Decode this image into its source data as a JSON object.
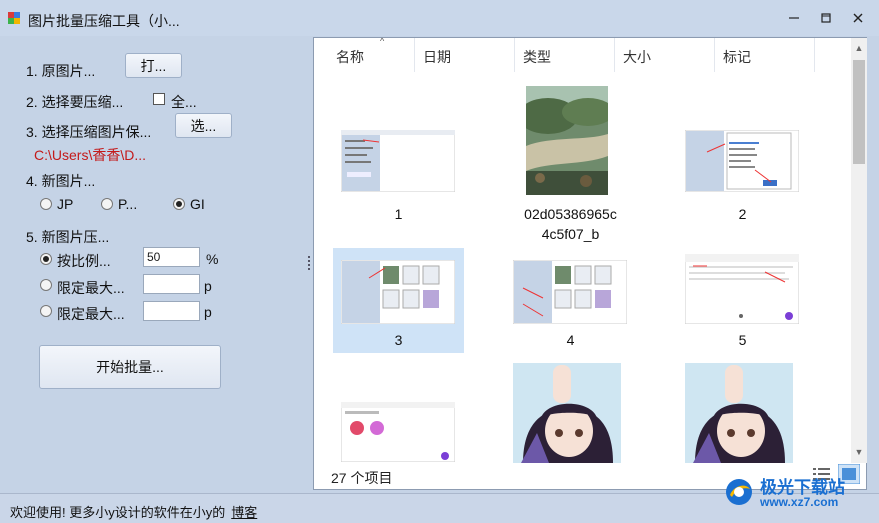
{
  "window": {
    "title": "图片批量压缩工具（小...",
    "minimize_icon": "minimize-icon",
    "maximize_icon": "maximize-icon",
    "close_icon": "close-icon"
  },
  "left": {
    "step1_label": "1. 原图片...",
    "open_button": "打...",
    "step2_label": "2. 选择要压缩...",
    "select_all_label": "全...",
    "step3_label": "3. 选择压缩图片保...",
    "choose_button": "选...",
    "save_path": "C:\\Users\\香香\\D...",
    "step4_label": "4. 新图片...",
    "format_options": [
      "JP",
      "P...",
      "GI"
    ],
    "format_selected": "GI",
    "step5_label": "5. 新图片压...",
    "ratio_label": "按比例...",
    "ratio_value": "50",
    "ratio_unit": "%",
    "max_width_label": "限定最大...",
    "max_width_unit": "p",
    "max_height_label": "限定最大...",
    "max_height_unit": "p",
    "size_mode_selected": "按比例...",
    "start_button": "开始批量..."
  },
  "explorer": {
    "columns": [
      "名称",
      "日期",
      "类型",
      "大小",
      "标记"
    ],
    "sort_column": "名称",
    "items": [
      {
        "label": "1",
        "kind": "screenshot"
      },
      {
        "label": "02d05386965c\n4c5f07_b",
        "kind": "landscape-photo"
      },
      {
        "label": "2",
        "kind": "screenshot"
      },
      {
        "label": "3",
        "kind": "screenshot",
        "selected": true
      },
      {
        "label": "4",
        "kind": "screenshot"
      },
      {
        "label": "5",
        "kind": "screenshot"
      },
      {
        "label": "",
        "kind": "screenshot"
      },
      {
        "label": "",
        "kind": "anime-art"
      },
      {
        "label": "",
        "kind": "anime-art"
      }
    ],
    "item_count": "27 个项目",
    "view_icons": [
      "details-view-icon",
      "large-icons-view-icon"
    ]
  },
  "status_bar": {
    "text": "欢迎使用! 更多小y设计的软件在小y的",
    "link": "博客"
  },
  "watermark": {
    "brand": "极光下载站",
    "url": "www.xz7.com"
  },
  "colors": {
    "panel_bg": "#c5d3e6",
    "selected_tile": "#cfe3f7",
    "path_red": "#c41a1a",
    "accent_blue": "#1a6fd1"
  }
}
